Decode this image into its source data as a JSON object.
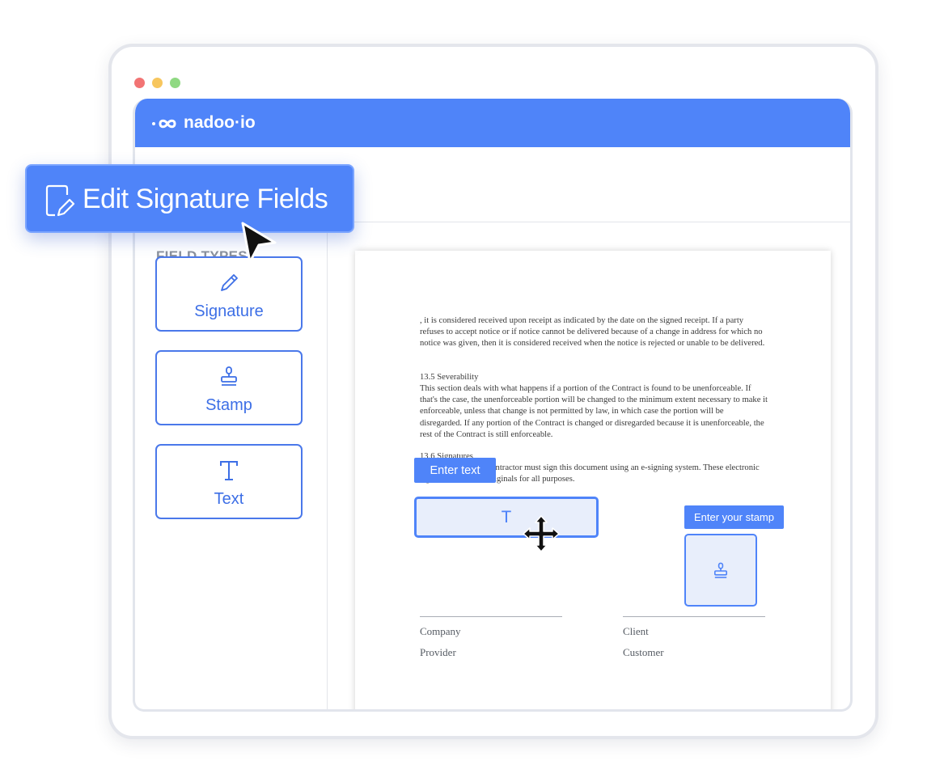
{
  "window": {
    "traffic_lights": [
      "close",
      "minimize",
      "maximize"
    ]
  },
  "topbar": {
    "logo_text": "nadoo·io",
    "logo_prefix_icon": "infinity-icon",
    "color": "#4f84f9"
  },
  "sidebar": {
    "title": "FIELD TYPES",
    "items": [
      {
        "label": "Signature",
        "icon": "pencil-icon"
      },
      {
        "label": "Stamp",
        "icon": "stamp-icon"
      },
      {
        "label": "Text",
        "icon": "text-t-icon"
      }
    ]
  },
  "action_button": {
    "label": "Edit Signature Fields",
    "icon": "edit-document-icon"
  },
  "document": {
    "paragraph1": ", it is considered received upon receipt as indicated by the date on the signed receipt. If a party refuses to accept notice or if notice cannot be delivered because of a change in address for which no notice was given, then it is considered received when the notice is rejected or unable to be delivered.",
    "section_heading": "13.5 Severability",
    "paragraph2": "This section deals with what happens if a portion of the Contract is found to be unenforceable. If that's the case, the unenforceable portion will be changed to the minimum extent necessary to make it enforceable, unless that change is not permitted by law, in which case the portion will be disregarded. If any portion of the Contract is changed or disregarded because it is unenforceable, the rest of the Contract is still enforceable.",
    "signatures_heading": "13.6 Signatures",
    "paragraph3": "The Client and the Contractor must sign this document using an e-signing system. These electronic signatures count as originals for all purposes.",
    "left_signer": {
      "line1": "Company",
      "line2": "Provider"
    },
    "right_signer": {
      "line1": "Client",
      "line2": "Customer"
    }
  },
  "fields": {
    "text_field_tag": "Enter text",
    "text_field_glyph": "T",
    "stamp_field_tag": "Enter your stamp",
    "stamp_field_icon": "stamp-icon"
  },
  "cursors": [
    "move-cursor",
    "arrow-pointer"
  ],
  "colors": {
    "accent": "#4f84f9",
    "field_fill": "#e8eefb",
    "card_border": "#4a78ea"
  }
}
